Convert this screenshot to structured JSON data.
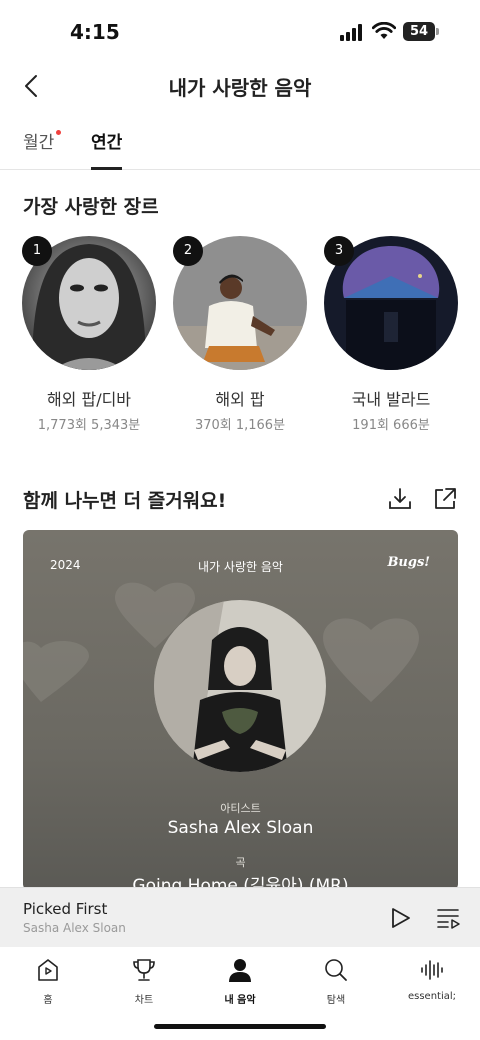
{
  "status_bar": {
    "time": "4:15",
    "battery": "54"
  },
  "header": {
    "title": "내가 사랑한 음악"
  },
  "tabs": [
    {
      "label": "월간",
      "has_dot": true
    },
    {
      "label": "연간",
      "selected": true
    }
  ],
  "genre_section": {
    "title": "가장 사랑한 장르",
    "items": [
      {
        "rank": "1",
        "name": "해외 팝/디바",
        "stats": "1,773회 5,343분"
      },
      {
        "rank": "2",
        "name": "해외 팝",
        "stats": "370회 1,166분"
      },
      {
        "rank": "3",
        "name": "국내 발라드",
        "stats": "191회 666분"
      }
    ]
  },
  "share_section": {
    "title": "함께 나누면 더 즐거워요!"
  },
  "share_card": {
    "year": "2024",
    "title": "내가 사랑한 음악",
    "logo": "Bugs!",
    "artist_label": "아티스트",
    "artist": "Sasha Alex Sloan",
    "song_label": "곡",
    "song": "Going Home (김윤아) (MR)"
  },
  "player": {
    "title": "Picked First",
    "artist": "Sasha Alex Sloan"
  },
  "nav": [
    {
      "label": "홈",
      "icon": "home-icon"
    },
    {
      "label": "차트",
      "icon": "trophy-icon"
    },
    {
      "label": "내 음악",
      "icon": "person-icon",
      "active": true
    },
    {
      "label": "탐색",
      "icon": "search-icon"
    },
    {
      "label": "essential;",
      "icon": "waveform-icon"
    }
  ],
  "colors": {
    "accent_dot": "#f0413e",
    "text": "#222222",
    "player_bg": "#efefef"
  }
}
